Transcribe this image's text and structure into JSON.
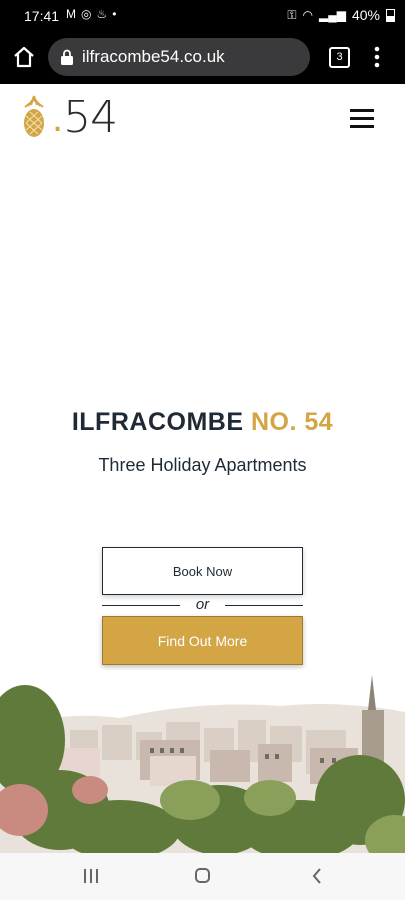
{
  "status_bar": {
    "time": "17:41",
    "battery_text": "40%",
    "icons_left": [
      "gmail-icon",
      "instagram-icon",
      "notification-icon",
      "dot-icon"
    ],
    "icons_right": [
      "key-icon",
      "wifi-icon",
      "signal-icon",
      "battery-icon"
    ]
  },
  "browser": {
    "url": "ilfracombe54.co.uk",
    "tab_count": "3"
  },
  "site": {
    "logo_number": "54",
    "title_main": "ILFRACOMBE",
    "title_accent": "NO. 54",
    "subtitle": "Three Holiday Apartments",
    "book_label": "Book Now",
    "or_label": "or",
    "find_label": "Find Out More",
    "accent_color": "#d3a545",
    "text_color": "#1f2a35"
  },
  "nav": {
    "buttons": [
      "recents-icon",
      "home-icon",
      "back-icon"
    ]
  }
}
